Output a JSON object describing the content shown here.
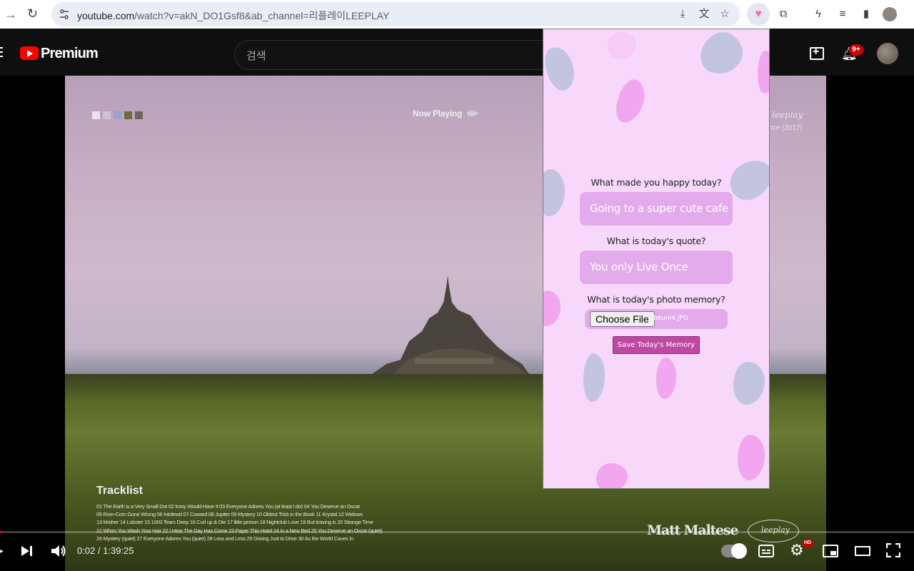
{
  "browser": {
    "url_host": "youtube.com",
    "url_path": "/watch?v=akN_DO1Gsf8&ab_channel=리플레이LEEPLAY"
  },
  "youtube": {
    "brand": "Premium",
    "search_placeholder": "검색",
    "notification_count": "9+"
  },
  "video": {
    "now_playing": "Now Playing",
    "right_script": "leeplay",
    "right_year": "nce (2017)",
    "tracklist_title": "Tracklist",
    "tracklist_lines": [
      "01 The Earth is a Very Small Dot  02 Irony Would Have It  03 Everyone Adores You (at least I do)  04 You Deserve an Oscar",
      "05 Rom-Com Gone Wrong  06 Intolewd  07 Coward  08 Jupiter  09 Mystery  10 Oldest Trick in the Book  11 Krystal  12 Widows",
      "13 Mother  14 Lobster  15 1000 Tears Deep  16 Curl up & Die  17 little person  18 Nightclub Love  19 But leaving is  20 Strange Time",
      "21 When You Wash Your Hair  22 I Hear The Day Has Come  23 Paper Thin Hotel  24 In a New Bed  25 You Deserve an Oscar (quiet)",
      "26 Mystery (quiet)  27 Everyone Adores You (quiet)  28 Less and Less  29 Driving Just to Drive  30 As the World Caves In"
    ],
    "artist": "Matt Maltese",
    "artist_logo": "leeplay",
    "swatch_colors": [
      "#e9e4ea",
      "#cfc3d3",
      "#9ea0c6",
      "#6e6b3d",
      "#6c6456"
    ]
  },
  "player": {
    "time": "0:02 / 1:39:25",
    "progress_fraction": 0.0003,
    "hd_label": "HD"
  },
  "popup": {
    "q1": "What made you happy today?",
    "a1": "Going to a super cute cafe",
    "q2": "What is today's quote?",
    "a2": "You only Live Once",
    "q3": "What is today's photo memory?",
    "choose_file": "Choose File",
    "file_name": "beuni4.JPG",
    "save": "Save Today's Memory",
    "colors": {
      "background": "#f7d8fb",
      "answer_box": "#e4abec",
      "save_button": "#bf49a2",
      "blob_pink": "#f2a6ef",
      "blob_blue": "#c3c4df"
    }
  }
}
